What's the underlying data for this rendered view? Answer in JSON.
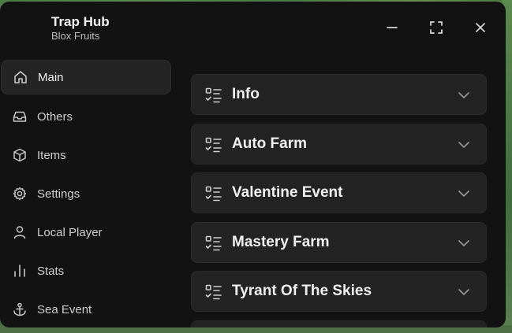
{
  "window": {
    "title": "Trap Hub",
    "subtitle": "Blox Fruits",
    "controls": [
      "minimize-icon",
      "maximize-icon",
      "close-icon"
    ]
  },
  "sidebar": {
    "items": [
      {
        "label": "Main",
        "icon": "home-icon",
        "active": true
      },
      {
        "label": "Others",
        "icon": "inbox-icon"
      },
      {
        "label": "Items",
        "icon": "box-icon"
      },
      {
        "label": "Settings",
        "icon": "gear-icon"
      },
      {
        "label": "Local Player",
        "icon": "user-icon"
      },
      {
        "label": "Stats",
        "icon": "bar-chart-icon"
      },
      {
        "label": "Sea Event",
        "icon": "anchor-icon"
      }
    ]
  },
  "main": {
    "sections": [
      {
        "label": "Info"
      },
      {
        "label": "Auto Farm"
      },
      {
        "label": "Valentine Event"
      },
      {
        "label": "Mastery Farm"
      },
      {
        "label": "Tyrant Of The Skies"
      }
    ]
  },
  "colors": {
    "window_bg": "#121212",
    "panel_bg": "#232323",
    "active_nav_bg": "#242424",
    "text_primary": "#f1f1f1",
    "text_secondary": "#bdbdbd",
    "icon": "#cfcfcf"
  }
}
